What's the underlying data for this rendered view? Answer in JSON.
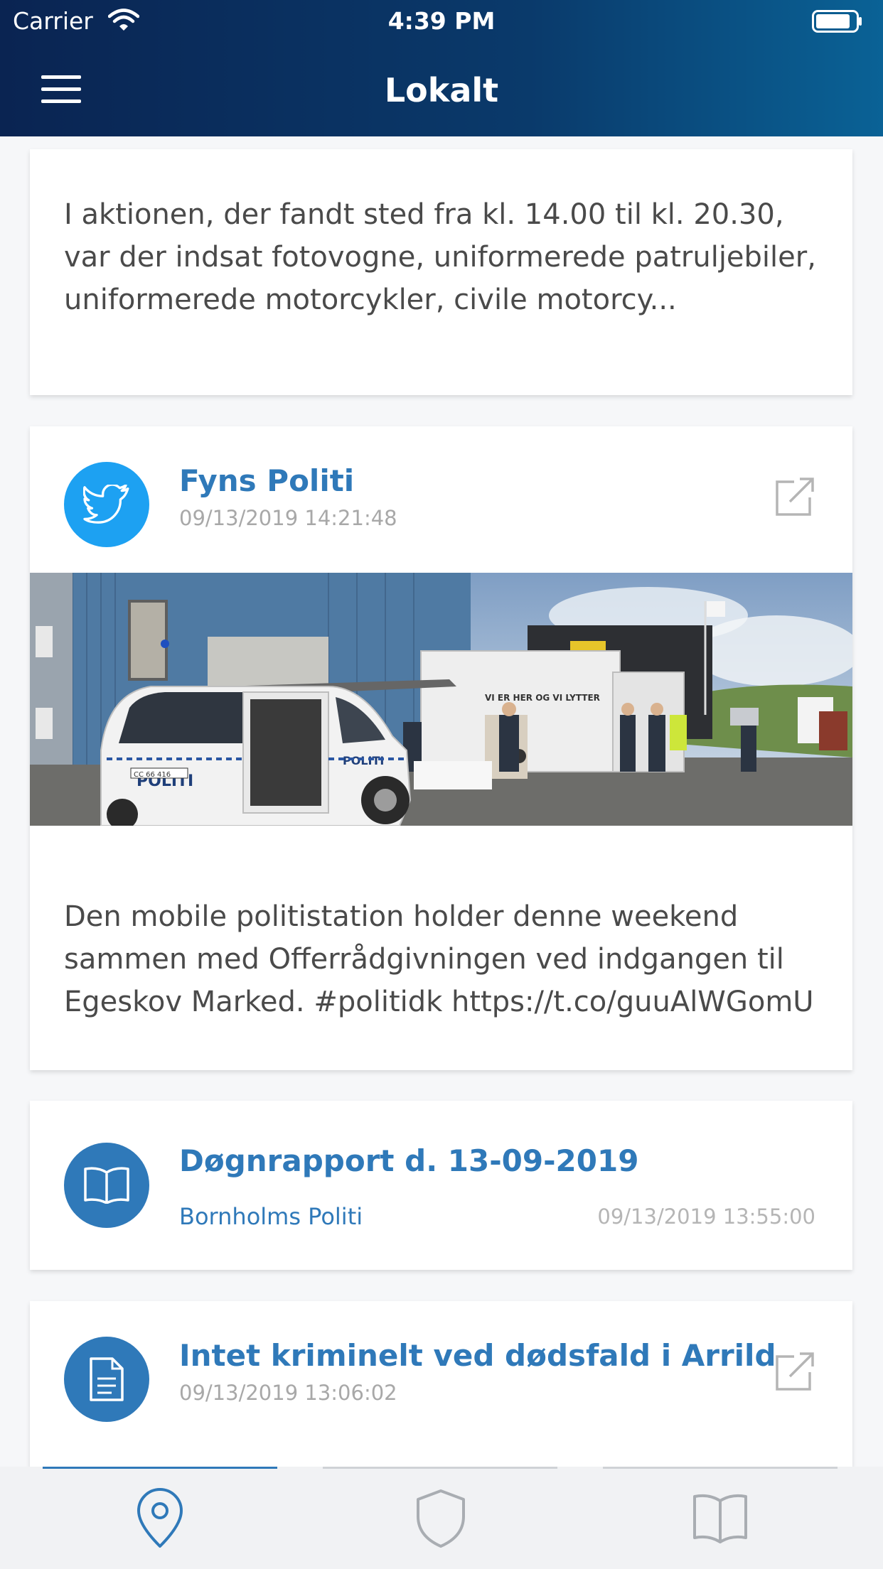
{
  "status_bar": {
    "carrier": "Carrier",
    "time": "4:39 PM"
  },
  "header": {
    "title": "Lokalt"
  },
  "feed": {
    "item0": {
      "excerpt": "I aktionen, der fandt sted fra kl. 14.00 til kl. 20.30, var der indsat fotovogne, uniformerede patruljebiler, uniformerede motorcykler, civile motorcy..."
    },
    "item1": {
      "source": "Fyns Politi",
      "date": "09/13/2019 14:21:48",
      "image_labels": {
        "politi": "POLITI",
        "plate": "CC 66 416",
        "trailer_sign": "VI ER HER OG VI LYTTER"
      },
      "text": "Den mobile politistation holder denne weekend sammen med Offerrådgivningen ved indgangen til Egeskov Marked. #politidk https://t.co/guuAlWGomU"
    },
    "item2": {
      "title": "Døgnrapport d. 13-09-2019",
      "source": "Bornholms Politi",
      "date": "09/13/2019 13:55:00"
    },
    "item3": {
      "title": "Intet kriminelt ved dødsfald i Arrild",
      "date": "09/13/2019 13:06:02"
    }
  },
  "tabs": [
    {
      "icon": "location-pin-icon",
      "selected": true
    },
    {
      "icon": "shield-icon",
      "selected": false
    },
    {
      "icon": "book-icon",
      "selected": false
    }
  ],
  "colors": {
    "accent": "#2f79b9",
    "twitter": "#1da1f2",
    "nav_dark": "#0a2452",
    "nav_light": "#0a6296"
  }
}
